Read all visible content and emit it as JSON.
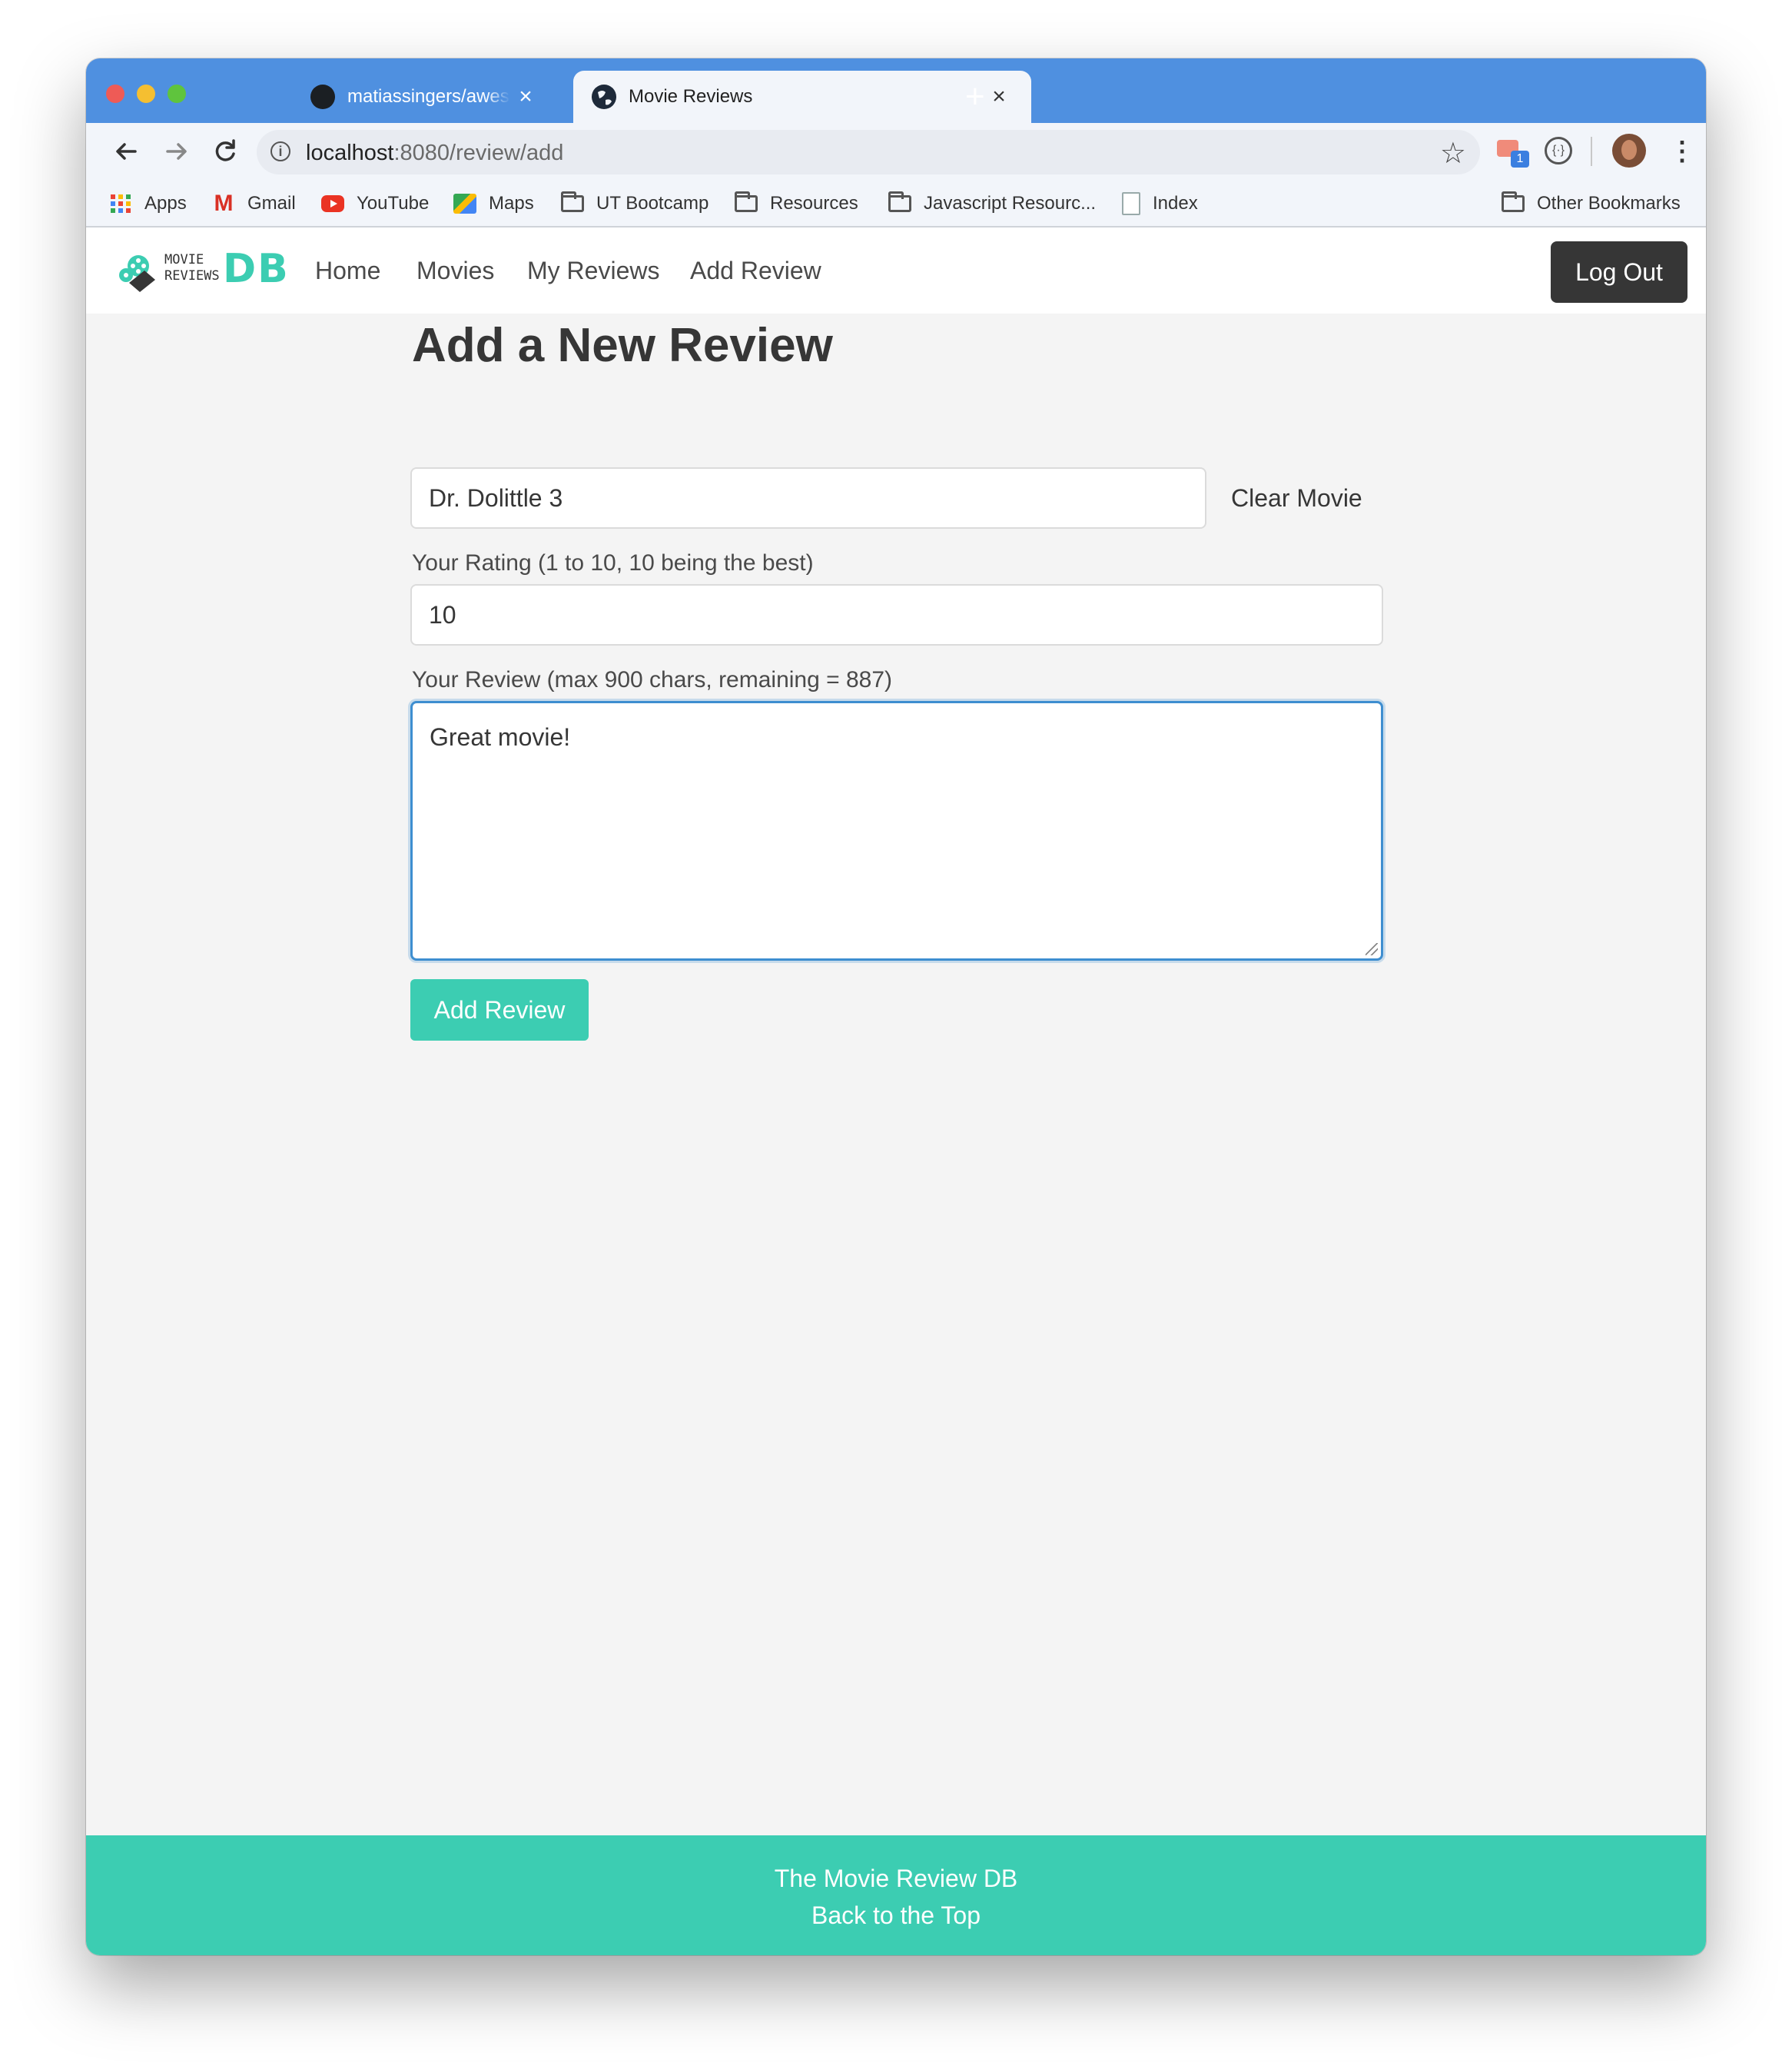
{
  "browser": {
    "tabs": [
      {
        "title": "matiassingers/awesome-readme",
        "active": false
      },
      {
        "title": "Movie Reviews",
        "active": true
      }
    ],
    "new_tab_label": "+",
    "close_label": "×",
    "url_host": "localhost",
    "url_path": ":8080/review/add",
    "bookmarks": [
      "Apps",
      "Gmail",
      "YouTube",
      "Maps",
      "UT Bootcamp",
      "Resources",
      "Javascript Resourc...",
      "Index"
    ],
    "other_bookmarks": "Other Bookmarks",
    "extension_badge": "1"
  },
  "app": {
    "logo": {
      "small_top": "MOVIE",
      "small_bottom": "REVIEWS",
      "big": "DB"
    },
    "nav": [
      "Home",
      "Movies",
      "My Reviews",
      "Add Review"
    ],
    "logout_label": "Log Out",
    "accent_color": "#3ccdb2"
  },
  "form": {
    "heading": "Add a New Review",
    "movie_value": "Dr. Dolittle 3",
    "clear_label": "Clear Movie",
    "rating_label": "Your Rating (1 to 10, 10 being the best)",
    "rating_value": "10",
    "review_label": "Your Review (max 900 chars, remaining = 887)",
    "review_value": "Great movie!",
    "submit_label": "Add Review"
  },
  "footer": {
    "title": "The Movie Review DB",
    "back_to_top": "Back to the Top"
  }
}
